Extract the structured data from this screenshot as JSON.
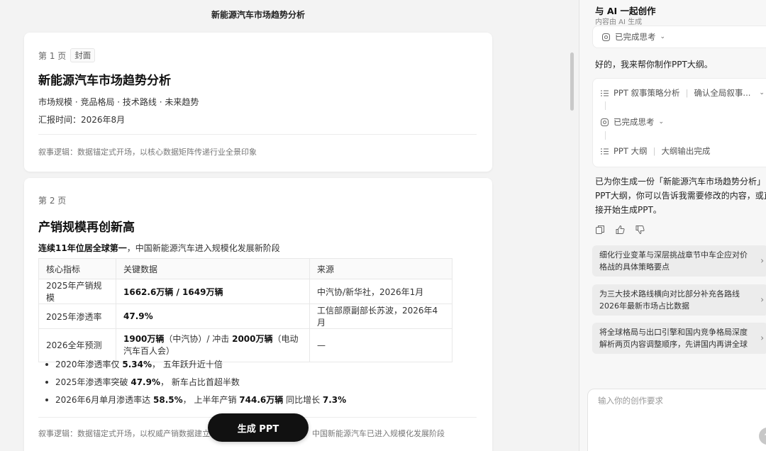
{
  "doc": {
    "title": "新能源汽车市场趋势分析",
    "generate_button": "生成 PPT",
    "page1": {
      "page_label": "第 1 页",
      "tag": "封面",
      "title": "新能源汽车市场趋势分析",
      "subtitle": "市场规模 · 竞品格局 · 技术路线 · 未来趋势",
      "date": "汇报时间：2026年8月",
      "narrative": "叙事逻辑：数据锚定式开场，以核心数据矩阵传递行业全景印象"
    },
    "page2": {
      "page_label": "第 2 页",
      "title": "产销规模再创新高",
      "lead_bold": "连续11年位居全球第一",
      "lead_rest": "，中国新能源汽车进入规模化发展新阶段",
      "table": {
        "headers": [
          "核心指标",
          "关键数据",
          "来源"
        ],
        "rows": [
          {
            "metric": "2025年产销规模",
            "data_bold": "1662.6万辆 / 1649万辆",
            "source": "中汽协/新华社，2026年1月"
          },
          {
            "metric": "2025年渗透率",
            "data_bold": "47.9%",
            "source": "工信部原副部长苏波，2026年4月"
          },
          {
            "metric": "2026全年预测",
            "data_b1": "1900万辆",
            "data_t1": "（中汽协）/ 冲击 ",
            "data_b2": "2000万辆",
            "data_t2": "（电动汽车百人会）",
            "source": "—"
          }
        ]
      },
      "bullets": [
        {
          "t1": "2020年渗透率仅 ",
          "b1": "5.34%",
          "t2": "， 五年跃升近十倍",
          "b2": "",
          "t3": "",
          "b3": ""
        },
        {
          "t1": "2025年渗透率突破 ",
          "b1": "47.9%",
          "t2": "， 新车占比首超半数",
          "b2": "",
          "t3": "",
          "b3": ""
        },
        {
          "t1": "2026年6月单月渗透率达 ",
          "b1": "58.5%",
          "t2": "， 上半年产销 ",
          "b2": "744.6万辆",
          "t3": " 同比增长 ",
          "b3": "7.3%"
        }
      ],
      "narrative_left": "叙事逻辑：数据锚定式开场，以权威产销数据建立",
      "narrative_right": "中国新能源汽车已进入规模化发展阶段"
    }
  },
  "ai": {
    "title": "与 AI 一起创作",
    "subtitle": "内容由 AI 生成",
    "thinking_done": "已完成思考",
    "message1": "好的，我来帮你制作PPT大纲。",
    "steps": {
      "strategy_label": "PPT 叙事策略分析",
      "strategy_status": "确认全局叙事...",
      "thinking_done": "已完成思考",
      "outline_label": "PPT 大纲",
      "outline_status": "大纲输出完成"
    },
    "message2_line1": "已为你生成一份「新能源汽车市场趋势分析」的",
    "message2_line2": "PPT大纲，你可以告诉我需要修改的内容，或直",
    "message2_line3": "接开始生成PPT。",
    "suggestions": [
      "细化行业变革与深层挑战章节中车企应对价格战的具体策略要点",
      "为三大技术路线横向对比部分补充各路线2026年最新市场占比数据",
      "将全球格局与出口引擎和国内竞争格局深度解析两页内容调整顺序，先讲国内再讲全球"
    ],
    "input_placeholder": "输入你的创作要求"
  }
}
